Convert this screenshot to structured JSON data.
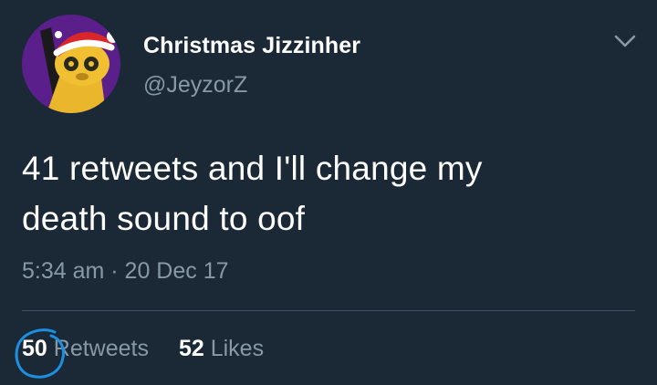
{
  "tweet": {
    "author": {
      "display_name": "Christmas Jizzinher",
      "handle": "@JeyzorZ",
      "avatar_icon": "cartoon-character-santa-hat-avatar"
    },
    "menu_icon": "chevron-down-icon",
    "text_lines": [
      "41 retweets and I'll change my",
      "death sound to oof"
    ],
    "timestamp": "5:34 am · 20 Dec 17",
    "stats": {
      "retweets": {
        "count": "50",
        "label": "Retweets"
      },
      "likes": {
        "count": "52",
        "label": "Likes"
      }
    },
    "annotation": {
      "type": "hand-drawn circle",
      "color": "#1d8fe0"
    }
  },
  "colors": {
    "background": "#1b2836",
    "primary_text": "#ffffff",
    "secondary_text": "#8899a6",
    "divider": "#425566",
    "avatar_background": "#5a1f8a"
  }
}
